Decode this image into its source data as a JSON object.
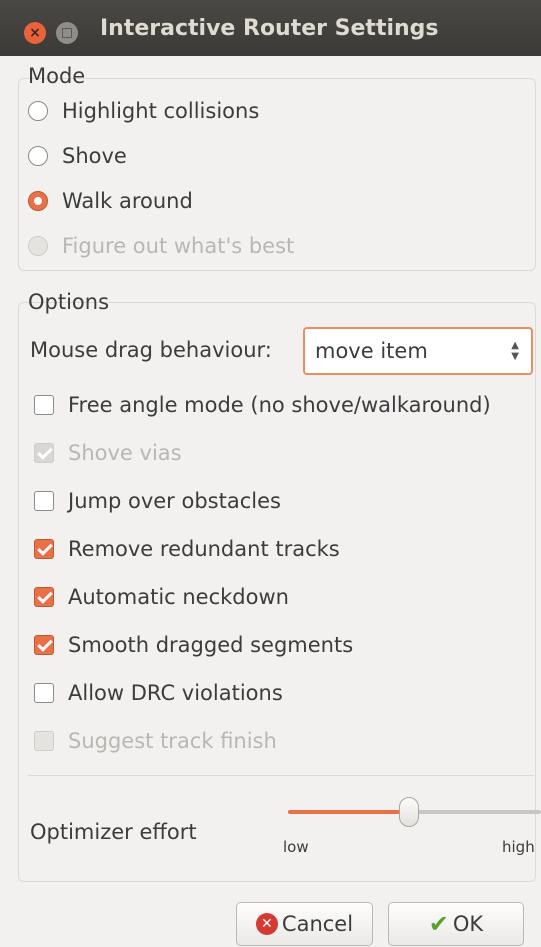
{
  "window": {
    "title": "Interactive Router Settings"
  },
  "mode": {
    "label": "Mode",
    "options": [
      {
        "label": "Highlight collisions",
        "selected": false,
        "enabled": true
      },
      {
        "label": "Shove",
        "selected": false,
        "enabled": true
      },
      {
        "label": "Walk around",
        "selected": true,
        "enabled": true
      },
      {
        "label": "Figure out what's best",
        "selected": false,
        "enabled": false
      }
    ]
  },
  "options": {
    "label": "Options",
    "mouse_drag": {
      "label": "Mouse drag behaviour:",
      "value": "move item"
    },
    "checkboxes": [
      {
        "label": "Free angle mode (no shove/walkaround)",
        "checked": false,
        "enabled": true
      },
      {
        "label": "Shove vias",
        "checked": true,
        "enabled": false
      },
      {
        "label": "Jump over obstacles",
        "checked": false,
        "enabled": true
      },
      {
        "label": "Remove redundant tracks",
        "checked": true,
        "enabled": true
      },
      {
        "label": "Automatic neckdown",
        "checked": true,
        "enabled": true
      },
      {
        "label": "Smooth dragged segments",
        "checked": true,
        "enabled": true
      },
      {
        "label": "Allow DRC violations",
        "checked": false,
        "enabled": true
      },
      {
        "label": "Suggest track finish",
        "checked": false,
        "enabled": false
      }
    ],
    "optimizer": {
      "label": "Optimizer effort",
      "low_label": "low",
      "high_label": "high",
      "level": 0.48
    }
  },
  "buttons": {
    "cancel": "Cancel",
    "ok": "OK"
  },
  "colors": {
    "accent": "#e9714a",
    "titlebar": "#3b3a36",
    "background": "#f2f1f0"
  }
}
